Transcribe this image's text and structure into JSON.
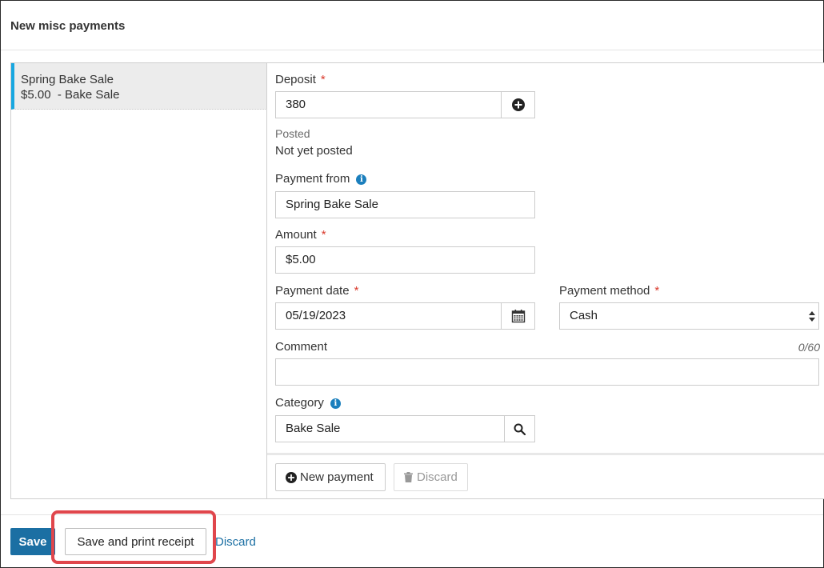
{
  "page": {
    "title": "New misc payments"
  },
  "list": {
    "items": [
      {
        "name": "Spring Bake Sale",
        "detail": "$5.00  - Bake Sale"
      }
    ]
  },
  "form": {
    "deposit": {
      "label": "Deposit",
      "required": "*",
      "value": "380"
    },
    "posted": {
      "label": "Posted",
      "value": "Not yet posted"
    },
    "payment_from": {
      "label": "Payment from",
      "value": "Spring Bake Sale"
    },
    "amount": {
      "label": "Amount",
      "required": "*",
      "value": "$5.00"
    },
    "payment_date": {
      "label": "Payment date",
      "required": "*",
      "value": "05/19/2023"
    },
    "payment_method": {
      "label": "Payment method",
      "required": "*",
      "value": "Cash"
    },
    "comment": {
      "label": "Comment",
      "value": "",
      "counter": "0/60"
    },
    "category": {
      "label": "Category",
      "value": "Bake Sale"
    },
    "new_payment_label": "New payment",
    "discard_label": "Discard"
  },
  "footer": {
    "save_label": "Save",
    "save_print_label": "Save and print receipt",
    "discard_label": "Discard"
  },
  "colors": {
    "accent": "#1b6fa3",
    "highlight": "#e0464c",
    "selected_bar": "#18a7e0",
    "required": "#d9392b"
  }
}
